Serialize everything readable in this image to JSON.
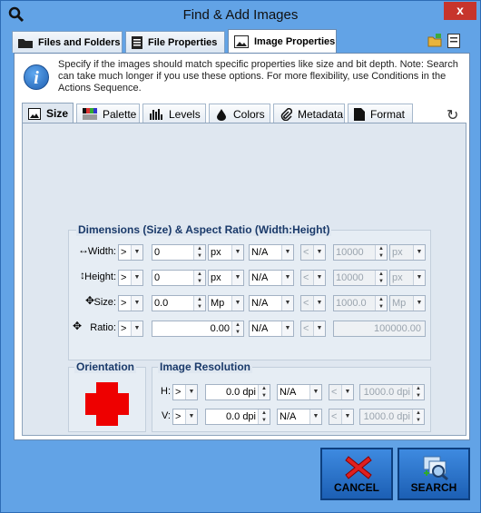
{
  "window": {
    "title": "Find & Add Images",
    "close_label": "x"
  },
  "main_tabs": [
    {
      "label": "Files and Folders",
      "icon": "folder-icon"
    },
    {
      "label": "File Properties",
      "icon": "document-icon"
    },
    {
      "label": "Image Properties",
      "icon": "image-icon"
    }
  ],
  "info": {
    "text": "Specify if the images should match specific properties like size and bit depth. Note: Search can take much longer if you use these options. For more flexibility, use Conditions in the Actions Sequence."
  },
  "sub_tabs": [
    {
      "label": "Size",
      "icon": "size-icon"
    },
    {
      "label": "Palette",
      "icon": "palette-icon"
    },
    {
      "label": "Levels",
      "icon": "levels-icon"
    },
    {
      "label": "Colors",
      "icon": "colors-icon"
    },
    {
      "label": "Metadata",
      "icon": "paperclip-icon"
    },
    {
      "label": "Format",
      "icon": "format-icon"
    }
  ],
  "dimensions": {
    "title": "Dimensions (Size) & Aspect Ratio (Width:Height)",
    "rows": [
      {
        "label": "Width:",
        "op": ">",
        "value": "0",
        "unit": "px",
        "mode": "N/A",
        "cmp": "<",
        "max": "10000",
        "max_unit": "px"
      },
      {
        "label": "Height:",
        "op": ">",
        "value": "0",
        "unit": "px",
        "mode": "N/A",
        "cmp": "<",
        "max": "10000",
        "max_unit": "px"
      },
      {
        "label": "Size:",
        "op": ">",
        "value": "0.0",
        "unit": "Mp",
        "mode": "N/A",
        "cmp": "<",
        "max": "1000.0",
        "max_unit": "Mp"
      },
      {
        "label": "Ratio:",
        "op": ">",
        "value": "0.00",
        "mode": "N/A",
        "cmp": "<",
        "max": "100000.00"
      }
    ]
  },
  "orientation": {
    "title": "Orientation"
  },
  "resolution": {
    "title": "Image Resolution",
    "rows": [
      {
        "label": "H:",
        "op": ">",
        "value": "0.0 dpi",
        "mode": "N/A",
        "cmp": "<",
        "max": "1000.0 dpi"
      },
      {
        "label": "V:",
        "op": ">",
        "value": "0.0 dpi",
        "mode": "N/A",
        "cmp": "<",
        "max": "1000.0 dpi"
      }
    ]
  },
  "buttons": {
    "cancel": "CANCEL",
    "search": "SEARCH"
  }
}
